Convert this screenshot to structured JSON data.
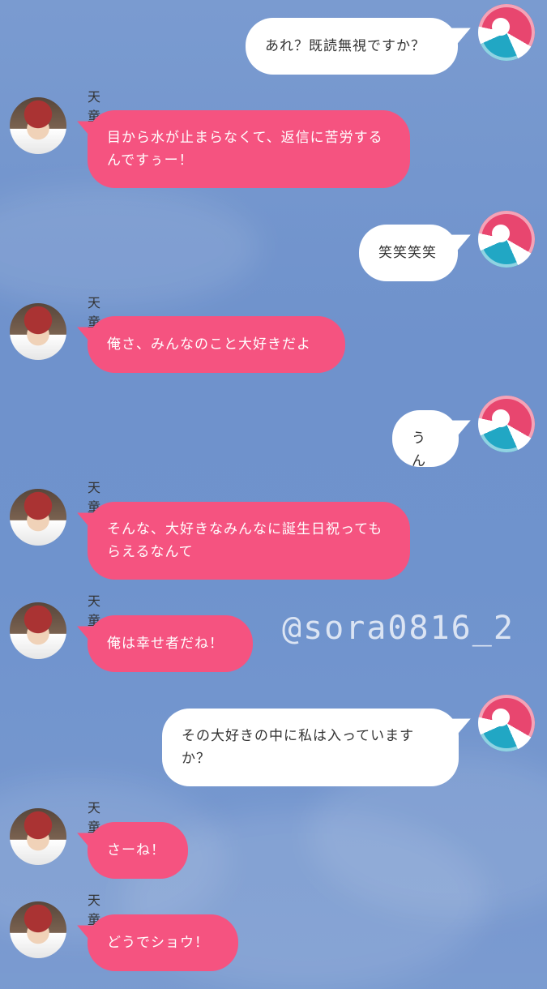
{
  "watermark": "@sora0816_2",
  "me": {
    "avatar_icon": "volleyball-icon"
  },
  "other": {
    "name": "天童",
    "avatar_icon": "tendo-avatar-icon"
  },
  "messages": [
    {
      "side": "me",
      "text": "あれ？既読無視ですか？"
    },
    {
      "side": "other",
      "name": "天童",
      "text": "目から水が止まらなくて、返信に苦労するんですぅー！"
    },
    {
      "side": "me",
      "text": "笑笑笑笑"
    },
    {
      "side": "other",
      "name": "天童",
      "text": "俺さ、みんなのこと大好きだよ"
    },
    {
      "side": "me",
      "text": "うん"
    },
    {
      "side": "other",
      "name": "天童",
      "text": "そんな、大好きなみんなに誕生日祝ってもらえるなんて"
    },
    {
      "side": "other",
      "name": "天童",
      "text": "俺は幸せ者だね！"
    },
    {
      "side": "me",
      "text": "その大好きの中に私は入っていますか？"
    },
    {
      "side": "other",
      "name": "天童",
      "text": "さーね！"
    },
    {
      "side": "other",
      "name": "天童",
      "text": "どうでショウ！"
    }
  ],
  "colors": {
    "background": "#7399cf",
    "my_bubble": "#ffffff",
    "their_bubble": "#f55380"
  }
}
